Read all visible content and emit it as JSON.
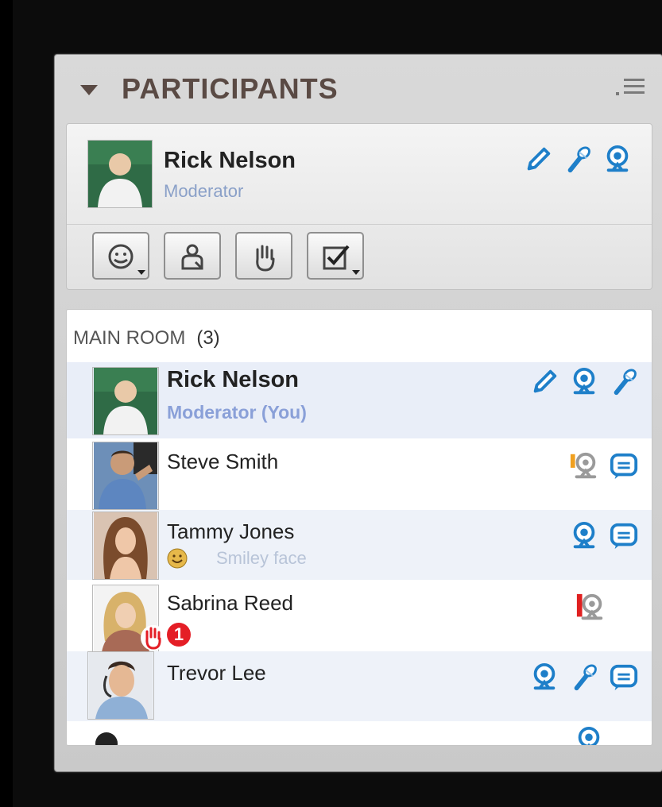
{
  "panel": {
    "title": "PARTICIPANTS"
  },
  "me": {
    "name": "Rick Nelson",
    "role": "Moderator"
  },
  "tools": [
    {
      "icon": "smiley-status-icon",
      "has_dropdown": true
    },
    {
      "icon": "user-role-icon",
      "has_dropdown": false
    },
    {
      "icon": "raise-hand-icon",
      "has_dropdown": false
    },
    {
      "icon": "checkbox-agree-icon",
      "has_dropdown": true
    }
  ],
  "room": {
    "title": "MAIN ROOM",
    "count": "(3)",
    "participants": [
      {
        "name": "Rick Nelson",
        "role": "Moderator (You)",
        "icons": [
          "pencil-icon",
          "webcam-icon",
          "microphone-icon"
        ]
      },
      {
        "name": "Steve Smith",
        "icons": [
          "webcam-warning-icon",
          "chat-icon"
        ]
      },
      {
        "name": "Tammy Jones",
        "status": "Smiley face",
        "icons": [
          "webcam-icon",
          "chat-icon"
        ]
      },
      {
        "name": "Sabrina Reed",
        "badge": "1",
        "icons": [
          "webcam-alert-icon"
        ]
      },
      {
        "name": "Trevor Lee",
        "icons": [
          "webcam-icon",
          "microphone-icon",
          "chat-icon"
        ]
      },
      {
        "name": "",
        "icons": [
          "webcam-icon"
        ]
      }
    ]
  },
  "colors": {
    "accent_blue": "#1e7fc9",
    "header_text": "#5a4a44",
    "role_text": "#8aa0c8",
    "badge_red": "#e41e26"
  }
}
